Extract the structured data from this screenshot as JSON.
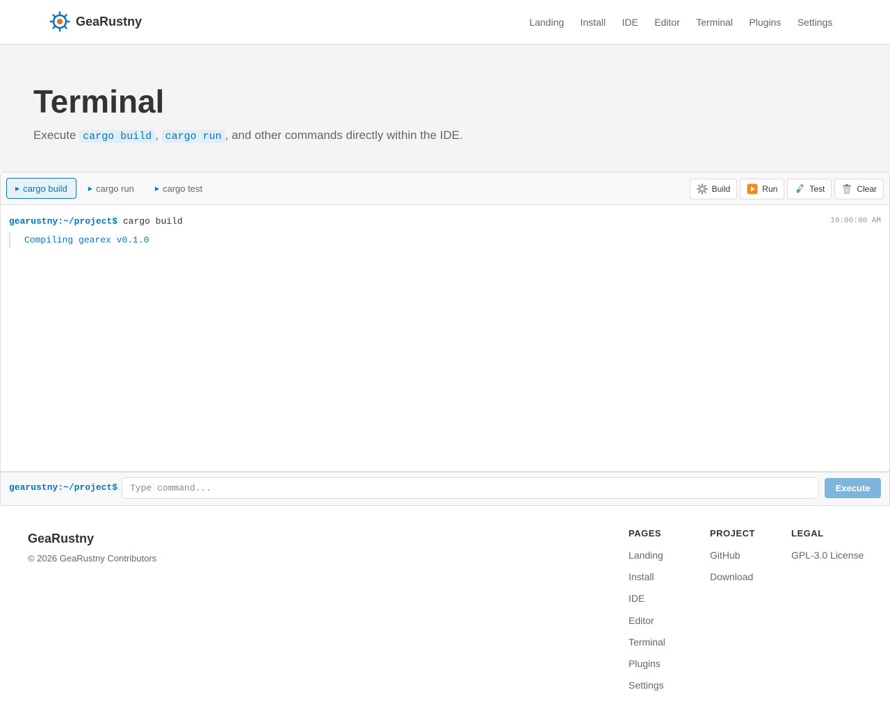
{
  "header": {
    "brand": "GeaRustny",
    "nav": [
      "Landing",
      "Install",
      "IDE",
      "Editor",
      "Terminal",
      "Plugins",
      "Settings"
    ]
  },
  "hero": {
    "title": "Terminal",
    "subtitle_pre": "Execute ",
    "code1": "cargo build",
    "sep": ", ",
    "code2": "cargo run",
    "subtitle_post": ", and other commands directly within the IDE."
  },
  "terminal": {
    "tabs": [
      {
        "label": "cargo build",
        "active": true
      },
      {
        "label": "cargo run",
        "active": false
      },
      {
        "label": "cargo test",
        "active": false
      }
    ],
    "actions": [
      {
        "label": "Build",
        "icon": "gear-icon"
      },
      {
        "label": "Run",
        "icon": "play-icon"
      },
      {
        "label": "Test",
        "icon": "test-tube-icon"
      },
      {
        "label": "Clear",
        "icon": "trash-icon"
      }
    ],
    "entry": {
      "prompt": "gearustny:~/project$",
      "command": "cargo build",
      "timestamp": "10:00:00 AM",
      "output": "Compiling gearex v0.1.0"
    },
    "input": {
      "prompt": "gearustny:~/project$",
      "placeholder": "Type command...",
      "value": "",
      "execute_label": "Execute"
    }
  },
  "footer": {
    "brand": "GeaRustny",
    "copyright": "© 2026 GeaRustny Contributors",
    "columns": [
      {
        "heading": "PAGES",
        "links": [
          "Landing",
          "Install",
          "IDE",
          "Editor",
          "Terminal",
          "Plugins",
          "Settings"
        ]
      },
      {
        "heading": "PROJECT",
        "links": [
          "GitHub",
          "Download"
        ]
      },
      {
        "heading": "LEGAL",
        "links": [
          "GPL-3.0 License"
        ]
      }
    ]
  },
  "colors": {
    "accent": "#0077bb",
    "logo_center": "#ff6600",
    "hero_bg": "#f4f4f4",
    "execute_bg": "#7db5dc"
  }
}
